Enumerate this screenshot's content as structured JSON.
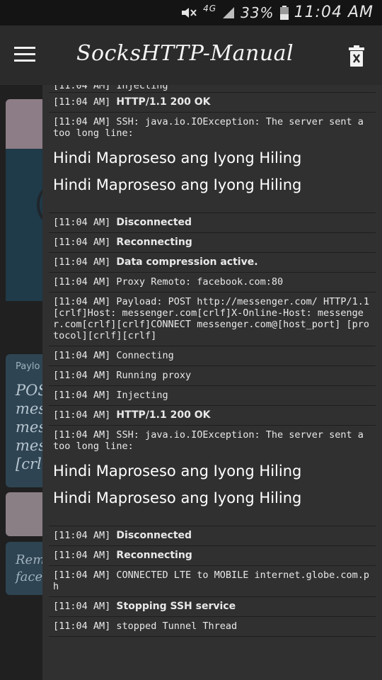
{
  "status_bar": {
    "network": "4G",
    "battery": "33%",
    "time": "11:04 AM"
  },
  "app_bar": {
    "title": "SocksHTTP-Manual"
  },
  "background": {
    "payload_label": "Paylo",
    "payload_text": "POS\nmes\nmes\nmes\n[crl",
    "remote_text": "Rem\nface"
  },
  "log": {
    "partial_top": "[11:04 AM] Injecting",
    "entries": [
      {
        "time": "[11:04 AM]",
        "text": "HTTP/1.1 200 OK",
        "bold": true
      },
      {
        "time": "[11:04 AM]",
        "text": "SSH: java.io.IOException: The server sent a too long line:",
        "bold": false,
        "big": [
          "Hindi Maproseso ang Iyong Hiling",
          "Hindi Maproseso ang Iyong Hiling"
        ]
      },
      {
        "time": "[11:04 AM]",
        "text": "Disconnected",
        "bold": true
      },
      {
        "time": "[11:04 AM]",
        "text": "Reconnecting",
        "bold": true
      },
      {
        "time": "[11:04 AM]",
        "text": "Data compression active.",
        "bold": true
      },
      {
        "time": "[11:04 AM]",
        "text": "Proxy Remoto: facebook.com:80",
        "bold": false
      },
      {
        "time": "[11:04 AM]",
        "text": "Payload: POST http://messenger.com/ HTTP/1.1[crlf]Host: messenger.com[crlf]X-Online-Host: messenger.com[crlf][crlf]CONNECT messenger.com@[host_port] [protocol][crlf][crlf]",
        "bold": false
      },
      {
        "time": "[11:04 AM]",
        "text": "Connecting",
        "bold": false
      },
      {
        "time": "[11:04 AM]",
        "text": "Running proxy",
        "bold": false
      },
      {
        "time": "[11:04 AM]",
        "text": "Injecting",
        "bold": false
      },
      {
        "time": "[11:04 AM]",
        "text": "HTTP/1.1 200 OK",
        "bold": true
      },
      {
        "time": "[11:04 AM]",
        "text": "SSH: java.io.IOException: The server sent a too long line:",
        "bold": false,
        "big": [
          "Hindi Maproseso ang Iyong Hiling",
          "Hindi Maproseso ang Iyong Hiling"
        ]
      },
      {
        "time": "[11:04 AM]",
        "text": "Disconnected",
        "bold": true
      },
      {
        "time": "[11:04 AM]",
        "text": "Reconnecting",
        "bold": true
      },
      {
        "time": "[11:04 AM]",
        "text": "CONNECTED LTE to MOBILE internet.globe.com.ph",
        "bold": false
      },
      {
        "time": "[11:04 AM]",
        "text": "Stopping SSH service",
        "bold": true
      },
      {
        "time": "[11:04 AM]",
        "text": "stopped Tunnel Thread",
        "bold": false
      }
    ]
  },
  "icons": {
    "menu": "hamburger-menu-icon",
    "clear": "delete-trash-icon",
    "mute": "mute-icon",
    "signal": "signal-icon",
    "battery": "battery-icon"
  }
}
